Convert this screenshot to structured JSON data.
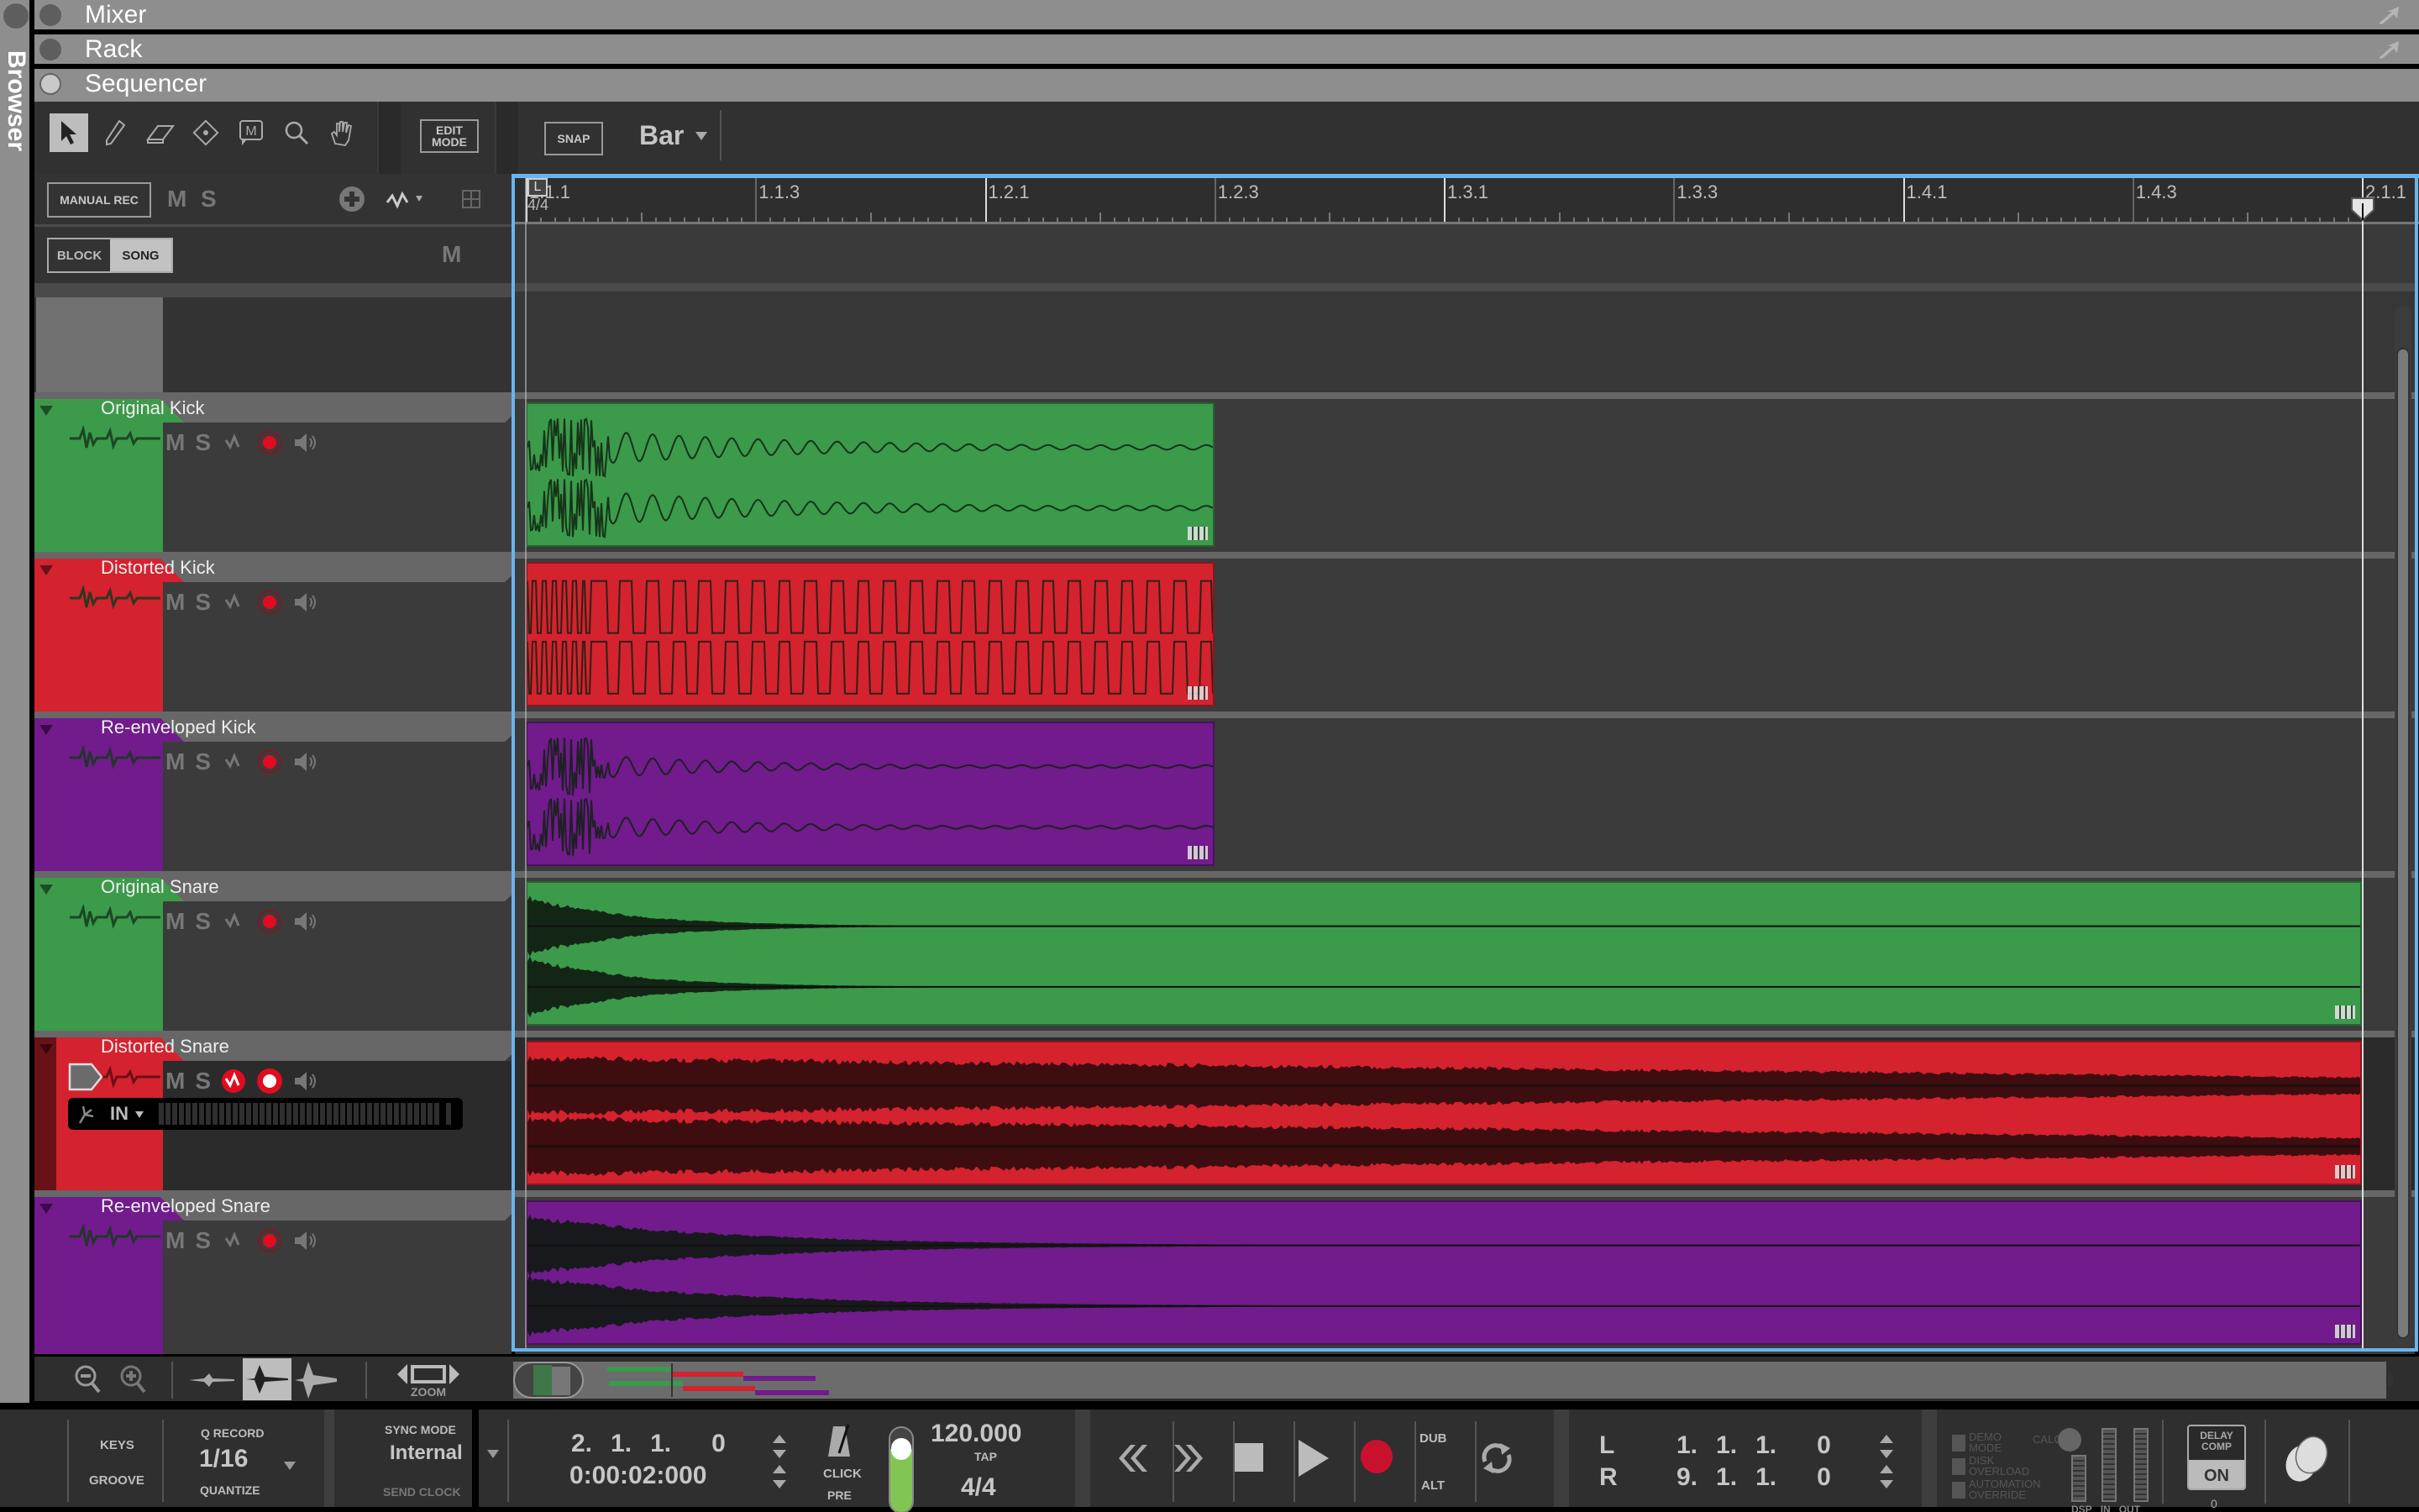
{
  "browser": {
    "label": "Browser"
  },
  "panels": [
    {
      "title": "Mixer",
      "active": false
    },
    {
      "title": "Rack",
      "active": false
    },
    {
      "title": "Sequencer",
      "active": true
    }
  ],
  "toolbar": {
    "tools": [
      "select-tool",
      "pencil-tool",
      "eraser-tool",
      "razor-tool",
      "mute-tool",
      "magnify-tool",
      "hand-tool"
    ],
    "edit_mode": "EDIT MODE",
    "snap": "SNAP",
    "snap_value": "Bar"
  },
  "sequencer": {
    "manual_rec": "MANUAL REC",
    "mute": "M",
    "solo": "S",
    "block": "BLOCK",
    "song": "SONG",
    "song_active": true,
    "master_mute": "M",
    "time_signature": "4/4",
    "ruler": [
      {
        "label": "1.1.1",
        "major": true
      },
      {
        "label": "1.1.3",
        "major": false
      },
      {
        "label": "1.2.1",
        "major": true
      },
      {
        "label": "1.2.3",
        "major": false
      },
      {
        "label": "1.3.1",
        "major": true
      },
      {
        "label": "1.3.3",
        "major": false
      },
      {
        "label": "1.4.1",
        "major": true
      },
      {
        "label": "1.4.3",
        "major": false
      },
      {
        "label": "2.1.1",
        "major": true
      }
    ],
    "tracks": [
      {
        "name": "Original Kick",
        "color": "#3c9a4b",
        "clip_end": 0.375,
        "wave": "kick",
        "selected": false
      },
      {
        "name": "Distorted Kick",
        "color": "#d4222f",
        "clip_end": 0.375,
        "wave": "square",
        "selected": false
      },
      {
        "name": "Re-enveloped Kick",
        "color": "#711b8c",
        "clip_end": 0.375,
        "wave": "kick2",
        "selected": false
      },
      {
        "name": "Original Snare",
        "color": "#3c9a4b",
        "clip_end": 1.0,
        "wave": "snare",
        "selected": false
      },
      {
        "name": "Distorted Snare",
        "color": "#d4222f",
        "clip_end": 1.0,
        "wave": "dsnare",
        "selected": true,
        "input": "IN"
      },
      {
        "name": "Re-enveloped Snare",
        "color": "#711b8c",
        "clip_end": 1.0,
        "wave": "esnare",
        "selected": false
      }
    ]
  },
  "zoombar": {
    "zoom_label": "ZOOM"
  },
  "transport": {
    "keys": "KEYS",
    "groove": "GROOVE",
    "q_record": "Q RECORD",
    "quantize_value": "1/16",
    "quantize": "QUANTIZE",
    "sync_mode": "SYNC MODE",
    "sync_value": "Internal",
    "send_clock": "SEND CLOCK",
    "position_bars": [
      "2.",
      "1.",
      "1.",
      "0"
    ],
    "position_time": "0:00:02:000",
    "click": "CLICK",
    "pre": "PRE",
    "click_level": 0.75,
    "tempo": "120.000",
    "tap": "TAP",
    "signature": "4/4",
    "dub": "DUB",
    "alt": "ALT",
    "loop_left_label": "L",
    "loop_left": [
      "1.",
      "1.",
      "1.",
      "0"
    ],
    "loop_right_label": "R",
    "loop_right": [
      "9.",
      "1.",
      "1.",
      "0"
    ],
    "demo_mode": "DEMO MODE",
    "disk_overload": "DISK OVERLOAD",
    "automation_override": "AUTOMATION OVERRIDE",
    "calc": "CALC",
    "dsp": "DSP",
    "in": "IN",
    "out": "OUT",
    "delay_comp": "DELAY COMP",
    "delay_comp_state": "ON",
    "delay_comp_value": "0"
  }
}
